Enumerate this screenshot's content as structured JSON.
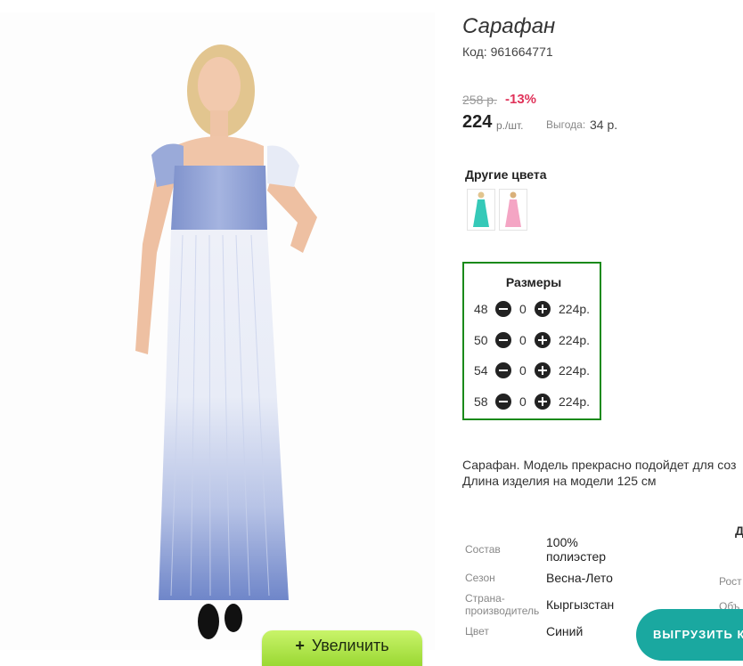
{
  "product": {
    "title": "Сарафан",
    "code": "Код: 961664771",
    "old_price": "258 р.",
    "discount": "-13%",
    "price": "224",
    "price_unit": "р./шт.",
    "savings_label": "Выгода:",
    "savings_value": "34 р."
  },
  "zoom": {
    "plus": "+",
    "label": "Увеличить"
  },
  "other_colors": {
    "title": "Другие цвета",
    "swatches": [
      {
        "color": "#35c9b8",
        "name": "mint"
      },
      {
        "color": "#f4a5c4",
        "name": "pink"
      }
    ]
  },
  "sizes": {
    "title": "Размеры",
    "rows": [
      {
        "size": "48",
        "qty": "0",
        "price": "224р."
      },
      {
        "size": "50",
        "qty": "0",
        "price": "224р."
      },
      {
        "size": "54",
        "qty": "0",
        "price": "224р."
      },
      {
        "size": "58",
        "qty": "0",
        "price": "224р."
      }
    ]
  },
  "description": {
    "line1": "Сарафан. Модель прекрасно подойдет для соз",
    "line2": "Длина изделия на модели 125 см"
  },
  "specs": [
    {
      "label": "Состав",
      "value": "100% полиэстер"
    },
    {
      "label": "Сезон",
      "value": "Весна-Лето"
    },
    {
      "label": "Страна-производитель",
      "value": "Кыргызстан"
    },
    {
      "label": "Цвет",
      "value": "Синий"
    }
  ],
  "side": {
    "letter": "Д",
    "rost": "Рост",
    "obj": "Объ"
  },
  "export_button": "ВЫГРУЗИТЬ К",
  "colors": {
    "accent_green": "#1a8a1a",
    "discount_red": "#e0335a",
    "teal": "#1aa8a0"
  }
}
